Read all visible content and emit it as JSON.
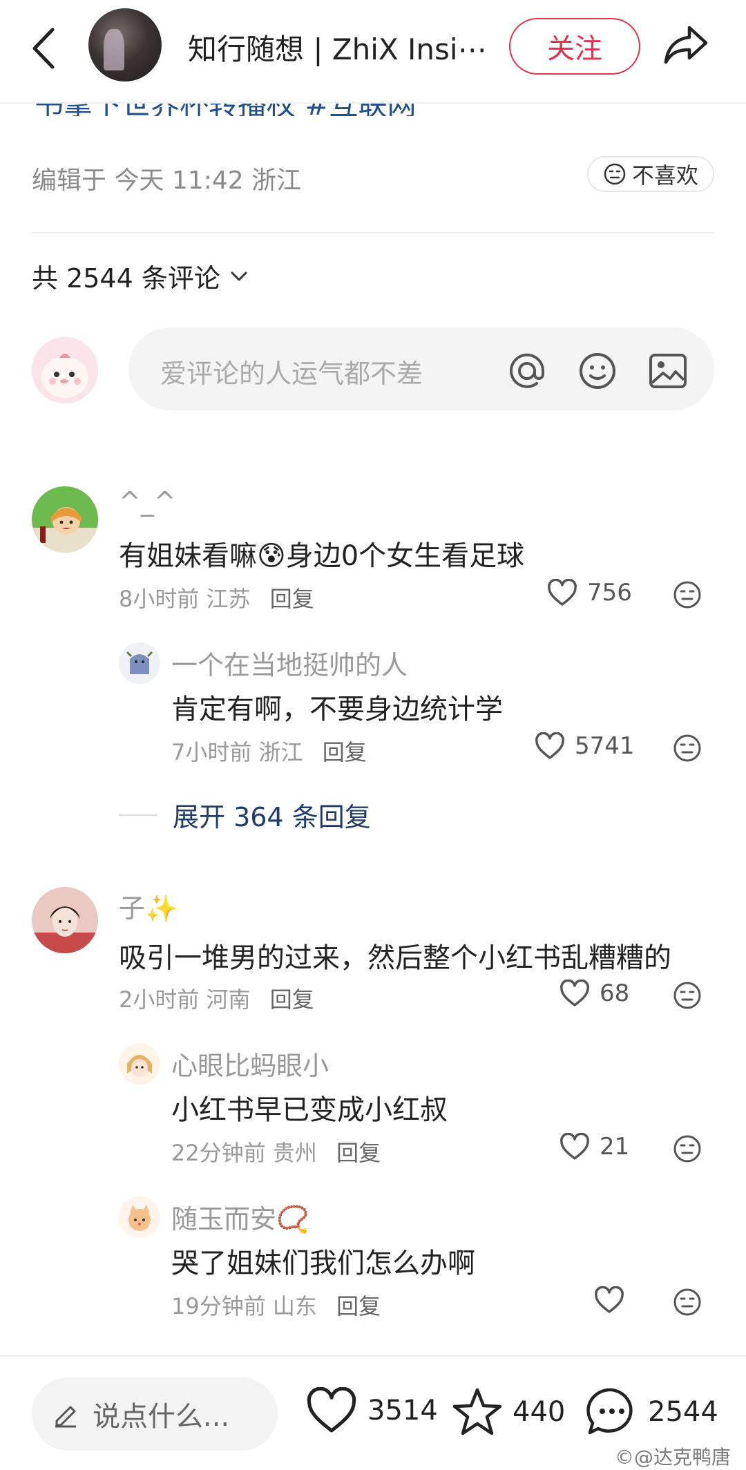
{
  "header": {
    "back_icon": "chevron-left-icon",
    "author_name": "知行随想 | ZhiX Insi⋯",
    "follow_label": "关注",
    "share_icon": "share-arrow-icon",
    "follow_color": "#e0344c"
  },
  "post": {
    "cut_line": "书拿下世界杯转播权 #互联网",
    "edit_info": "编辑于  今天 11:42 浙江",
    "dislike_label": "不喜欢"
  },
  "comments_header": {
    "count_label": "共 2544 条评论"
  },
  "input": {
    "placeholder": "爱评论的人运气都不差"
  },
  "comments": [
    {
      "name": "^_^",
      "text": "有姐妹看嘛😰身边0个女生看足球",
      "time": "8小时前",
      "location": "江苏",
      "reply_label": "回复",
      "likes": "756",
      "replies": [
        {
          "name": "一个在当地挺帅的人",
          "text": "肯定有啊，不要身边统计学",
          "time": "7小时前",
          "location": "浙江",
          "reply_label": "回复",
          "likes": "5741"
        }
      ],
      "expand_label": "展开 364 条回复"
    },
    {
      "name": "子✨",
      "text": "吸引一堆男的过来，然后整个小红书乱糟糟的",
      "time": "2小时前",
      "location": "河南",
      "reply_label": "回复",
      "likes": "68",
      "replies": [
        {
          "name": "心眼比蚂眼小",
          "text": "小红书早已变成小红叔",
          "time": "22分钟前",
          "location": "贵州",
          "reply_label": "回复",
          "likes": "21"
        },
        {
          "name": "随玉而安📿",
          "text": "哭了姐妹们我们怎么办啊",
          "time": "19分钟前",
          "location": "山东",
          "reply_label": "回复",
          "likes": ""
        }
      ]
    }
  ],
  "bottom_bar": {
    "say_placeholder": "说点什么...",
    "like_count": "3514",
    "star_count": "440",
    "comment_count": "2544"
  },
  "watermark": "©@达克鸭唐"
}
